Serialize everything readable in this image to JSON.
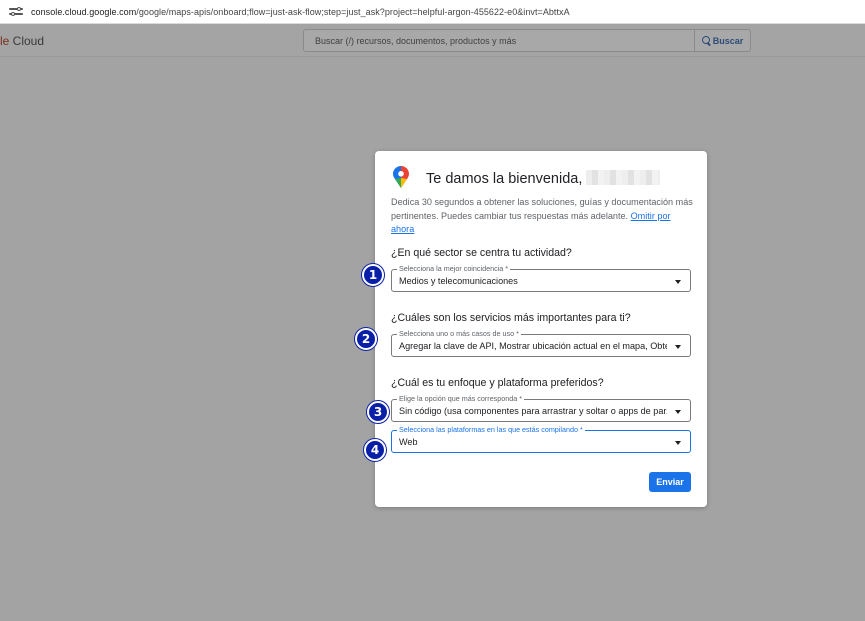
{
  "browser": {
    "url_host": "console.cloud.google.com",
    "url_path": "/google/maps-apis/onboard;flow=just-ask-flow;step=just_ask?project=helpful-argon-455622-e0&invt=AbttxA"
  },
  "header": {
    "logo_prefix": "le",
    "logo_suffix": " Cloud",
    "search_placeholder": "Buscar (/) recursos, documentos, productos y más",
    "search_button": "Buscar"
  },
  "dialog": {
    "title": "Te damos la bienvenida,",
    "description": "Dedica 30 segundos a obtener las soluciones, guías y documentación más pertinentes. Puedes cambiar tus respuestas más adelante. ",
    "skip_link": "Omitir por ahora",
    "questions": [
      {
        "heading": "¿En qué sector se centra tu actividad?",
        "fields": [
          {
            "label": "Selecciona la mejor coincidencia *",
            "value": "Medios y telecomunicaciones"
          }
        ]
      },
      {
        "heading": "¿Cuáles son los servicios más importantes para ti?",
        "fields": [
          {
            "label": "Selecciona uno o más casos de uso *",
            "value": "Agregar la clave de API, Mostrar ubicación actual en el mapa, Obte..."
          }
        ]
      },
      {
        "heading": "¿Cuál es tu enfoque y plataforma preferidos?",
        "fields": [
          {
            "label": "Elige la opción que más corresponda *",
            "value": "Sin código (usa componentes para arrastrar y soltar o apps de par..."
          },
          {
            "label": "Selecciona las plataformas en las que estás compilando *",
            "value": "Web"
          }
        ]
      }
    ],
    "submit": "Enviar"
  },
  "markers": [
    "1",
    "2",
    "3",
    "4"
  ],
  "colors": {
    "accent": "#1a73e8",
    "marker": "#0a1fa8",
    "overlay": "#a3a3a3"
  }
}
